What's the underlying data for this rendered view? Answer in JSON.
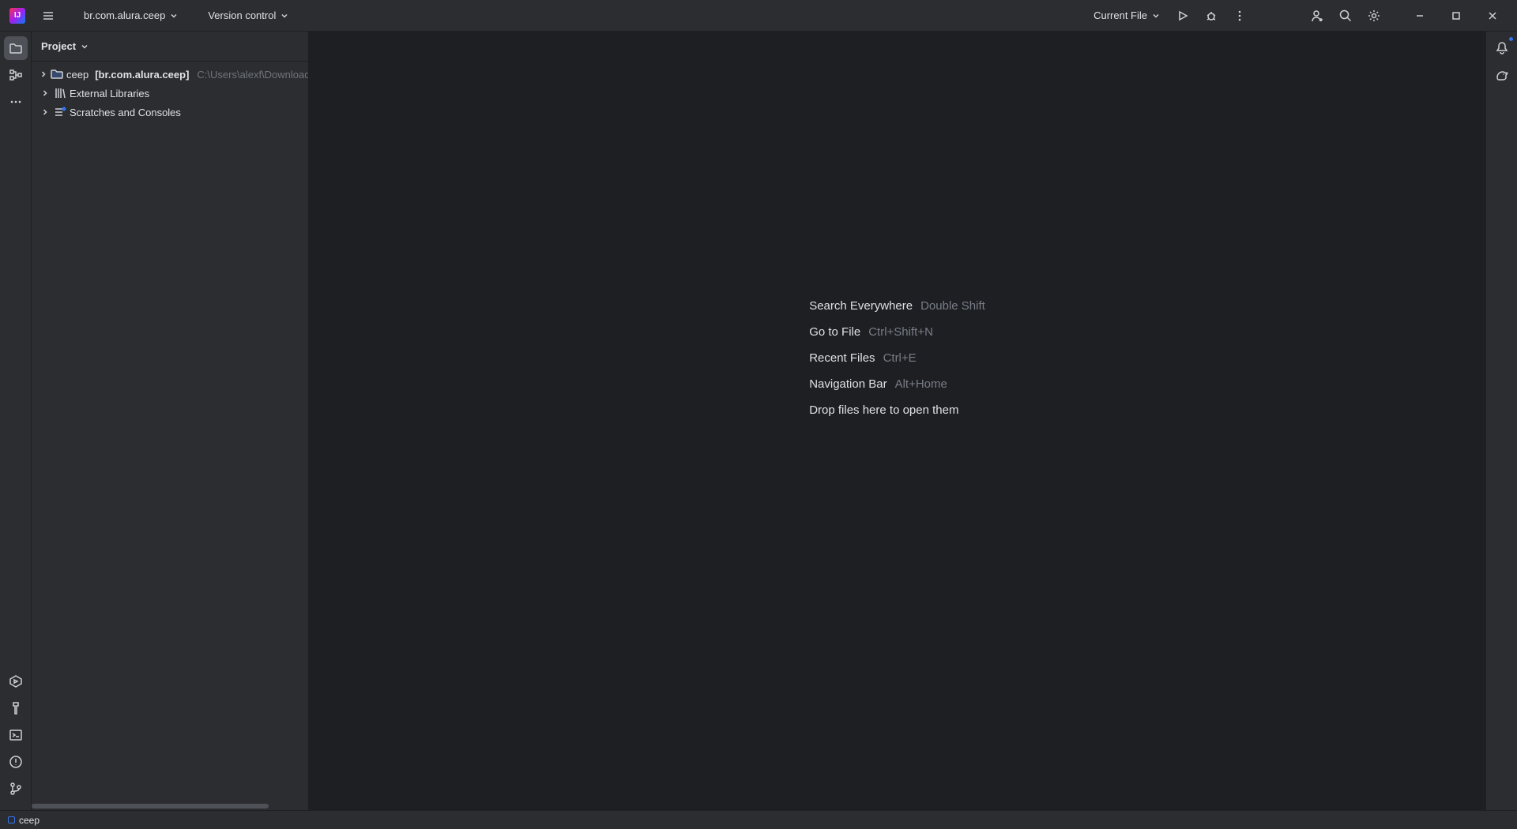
{
  "titlebar": {
    "project_dropdown": "br.com.alura.ceep",
    "vcs_dropdown": "Version control",
    "run_config": "Current File"
  },
  "project_panel": {
    "title": "Project",
    "root_name": "ceep",
    "root_qualifier": "[br.com.alura.ceep]",
    "root_path": "C:\\Users\\alexf\\Downloads\\kt",
    "external_libs": "External Libraries",
    "scratches": "Scratches and Consoles"
  },
  "welcome": {
    "items": [
      {
        "action": "Search Everywhere",
        "shortcut": "Double Shift"
      },
      {
        "action": "Go to File",
        "shortcut": "Ctrl+Shift+N"
      },
      {
        "action": "Recent Files",
        "shortcut": "Ctrl+E"
      },
      {
        "action": "Navigation Bar",
        "shortcut": "Alt+Home"
      },
      {
        "action": "Drop files here to open them",
        "shortcut": ""
      }
    ]
  },
  "statusbar": {
    "module": "ceep"
  }
}
